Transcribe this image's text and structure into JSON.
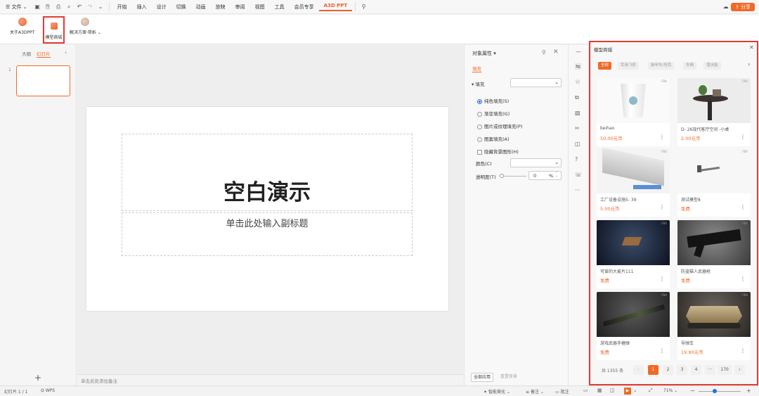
{
  "menubar": {
    "file": "文件",
    "tabs": [
      "开始",
      "插入",
      "设计",
      "切换",
      "动画",
      "放映",
      "审阅",
      "视图",
      "工具",
      "会员专享"
    ],
    "active_tab": "A3D PPT",
    "share": "分享"
  },
  "ribbon": {
    "about": "关于A3DPPT",
    "store": "模型商城",
    "solutions": "解决方案·简析"
  },
  "left_panel": {
    "tab_outline": "大纲",
    "tab_slides": "幻灯片",
    "slide_number": "1",
    "add": "+"
  },
  "slide": {
    "title": "空白演示",
    "subtitle": "单击此处输入副标题"
  },
  "notes_placeholder": "单击此处添加备注",
  "properties": {
    "title": "对象属性",
    "tab": "填充",
    "section": "填充",
    "options": [
      {
        "label": "纯色填充(S)",
        "selected": true
      },
      {
        "label": "渐变填充(G)",
        "selected": false
      },
      {
        "label": "图片或纹理填充(P)",
        "selected": false
      },
      {
        "label": "图案填充(A)",
        "selected": false
      }
    ],
    "hide_bg": "隐藏背景图形(H)",
    "color_label": "颜色(C)",
    "transparency_label": "透明度(T)",
    "transparency_value": "0",
    "transparency_unit": "%",
    "apply_all": "全部应用",
    "reset_bg": "重置背景"
  },
  "store": {
    "title": "模型商城",
    "categories": [
      "全部",
      "军用飞机",
      "装甲车/坦克",
      "车辆",
      "潜水艇"
    ],
    "items": [
      {
        "name": "beihao",
        "price": "50.00元币",
        "fmt": "FBX"
      },
      {
        "name": "D- 26现代客厅空间 -小桌",
        "price": "2.00元币",
        "fmt": "FBX"
      },
      {
        "name": "工厂设备设施5- 39",
        "price": "5.00元币",
        "fmt": "FBX"
      },
      {
        "name": "测试模型8",
        "price": "免费",
        "fmt": "FBX"
      },
      {
        "name": "可爱的大麦片111",
        "price": "免费",
        "fmt": "FBX"
      },
      {
        "name": "防盗猫人武器枪",
        "price": "免费",
        "fmt": "FBX"
      },
      {
        "name": "游戏武器手榴弹",
        "price": "免费",
        "fmt": "FBX"
      },
      {
        "name": "导弹车",
        "price": "19.90元币",
        "fmt": "FBX"
      }
    ],
    "total": "共 1355 条",
    "pages": [
      "1",
      "2",
      "3",
      "4",
      "···",
      "170"
    ]
  },
  "statusbar": {
    "slide_info": "幻灯片 1 / 1",
    "theme": "WPS",
    "beautify": "智能美化",
    "notes": "备注",
    "comment": "批注",
    "zoom": "71%"
  },
  "colors": {
    "accent": "#f06a26",
    "highlight": "#e53935"
  }
}
